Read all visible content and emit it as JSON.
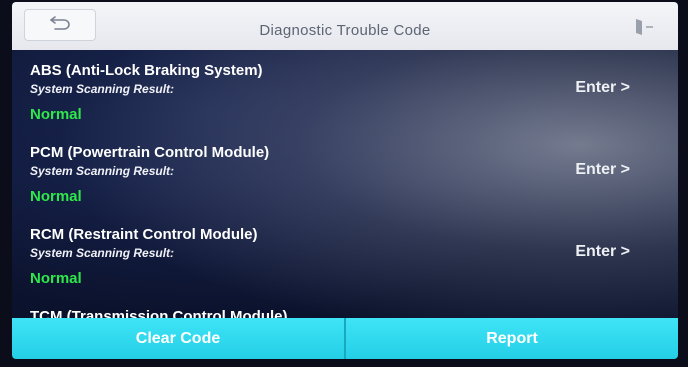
{
  "header": {
    "title": "Diagnostic Trouble Code",
    "back_icon": "back-arrow-icon",
    "exit_icon": "exit-door-icon"
  },
  "systems": [
    {
      "name": "ABS (Anti-Lock Braking System)",
      "scan_label": "System Scanning Result:",
      "status": "Normal",
      "action": "Enter >"
    },
    {
      "name": "PCM (Powertrain Control Module)",
      "scan_label": "System Scanning Result:",
      "status": "Normal",
      "action": "Enter >"
    },
    {
      "name": "RCM (Restraint Control Module)",
      "scan_label": "System Scanning Result:",
      "status": "Normal",
      "action": "Enter >"
    }
  ],
  "partial_row": {
    "name": "TCM (Transmission Control Module)"
  },
  "footer": {
    "clear_code": "Clear Code",
    "report": "Report"
  },
  "colors": {
    "accent": "#2ed6ea",
    "status_normal": "#2ee84a",
    "header_bg": "#eef0f4"
  }
}
